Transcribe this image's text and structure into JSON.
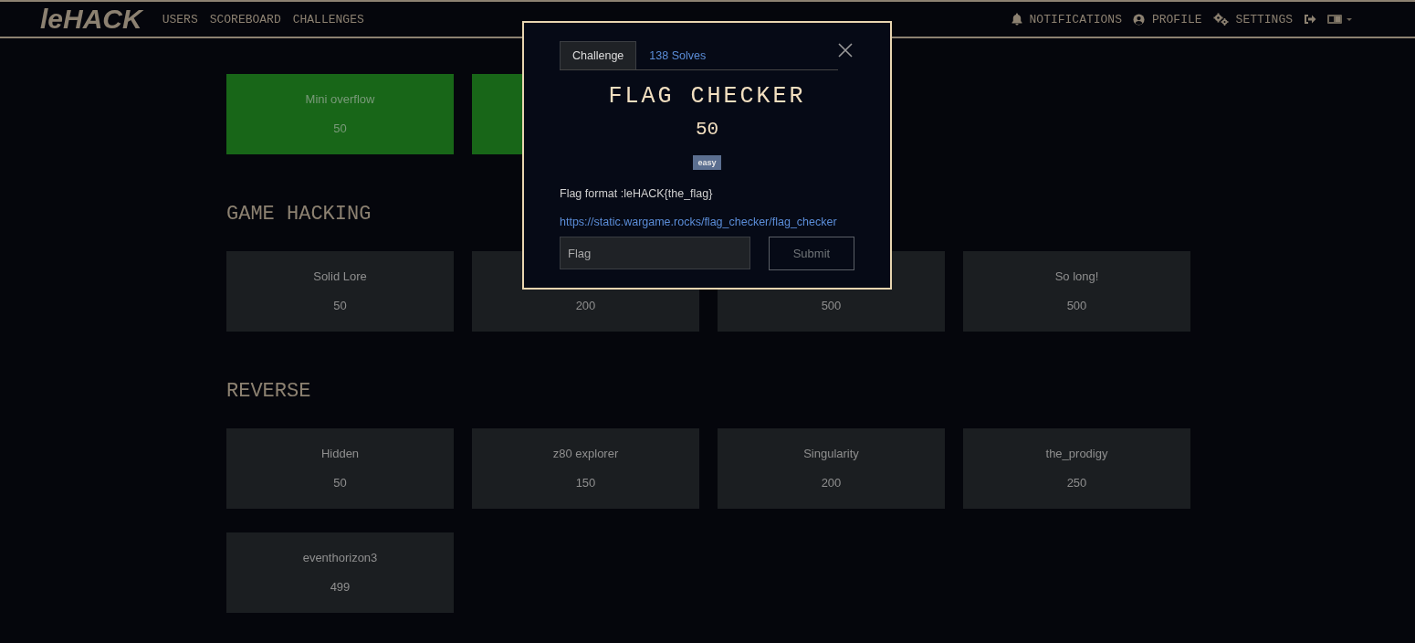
{
  "navbar": {
    "logo": "leHACK",
    "links": [
      {
        "label": "USERS"
      },
      {
        "label": "SCOREBOARD"
      },
      {
        "label": "CHALLENGES"
      }
    ],
    "right_links": [
      {
        "kind": "notifications",
        "label": "NOTIFICATIONS"
      },
      {
        "kind": "profile",
        "label": "PROFILE"
      },
      {
        "kind": "settings",
        "label": "SETTINGS"
      },
      {
        "kind": "logout"
      },
      {
        "kind": "language"
      }
    ]
  },
  "sections": [
    {
      "cards": [
        {
          "name": "Mini overflow",
          "points": "50",
          "solved": true
        },
        {
          "solved": true
        }
      ]
    },
    {
      "title": "GAME HACKING",
      "cards": [
        {
          "name": "Solid Lore",
          "points": "50",
          "solved": false
        },
        {
          "points": "200",
          "solved": false
        },
        {
          "points": "500",
          "solved": false
        },
        {
          "name": "So long!",
          "points": "500",
          "solved": false
        }
      ]
    },
    {
      "title": "REVERSE",
      "cards": [
        {
          "name": "Hidden",
          "points": "50",
          "solved": false
        },
        {
          "name": "z80 explorer",
          "points": "150",
          "solved": false
        },
        {
          "name": "Singularity",
          "points": "200",
          "solved": false
        },
        {
          "name": "the_prodigy",
          "points": "250",
          "solved": false
        },
        {
          "name": "eventhorizon3",
          "points": "499",
          "solved": false
        }
      ]
    }
  ],
  "modal": {
    "tabs": [
      {
        "label": "Challenge",
        "selected": true
      },
      {
        "label": "138 Solves",
        "selected": false
      }
    ],
    "title": "FLAG CHECKER",
    "value": "50",
    "badge": "easy",
    "description": "Flag format :leHACK{the_flag}",
    "link": "https://static.wargame.rocks/flag_checker/flag_checker",
    "input": {
      "placeholder": "Flag"
    },
    "submit": "Submit"
  }
}
